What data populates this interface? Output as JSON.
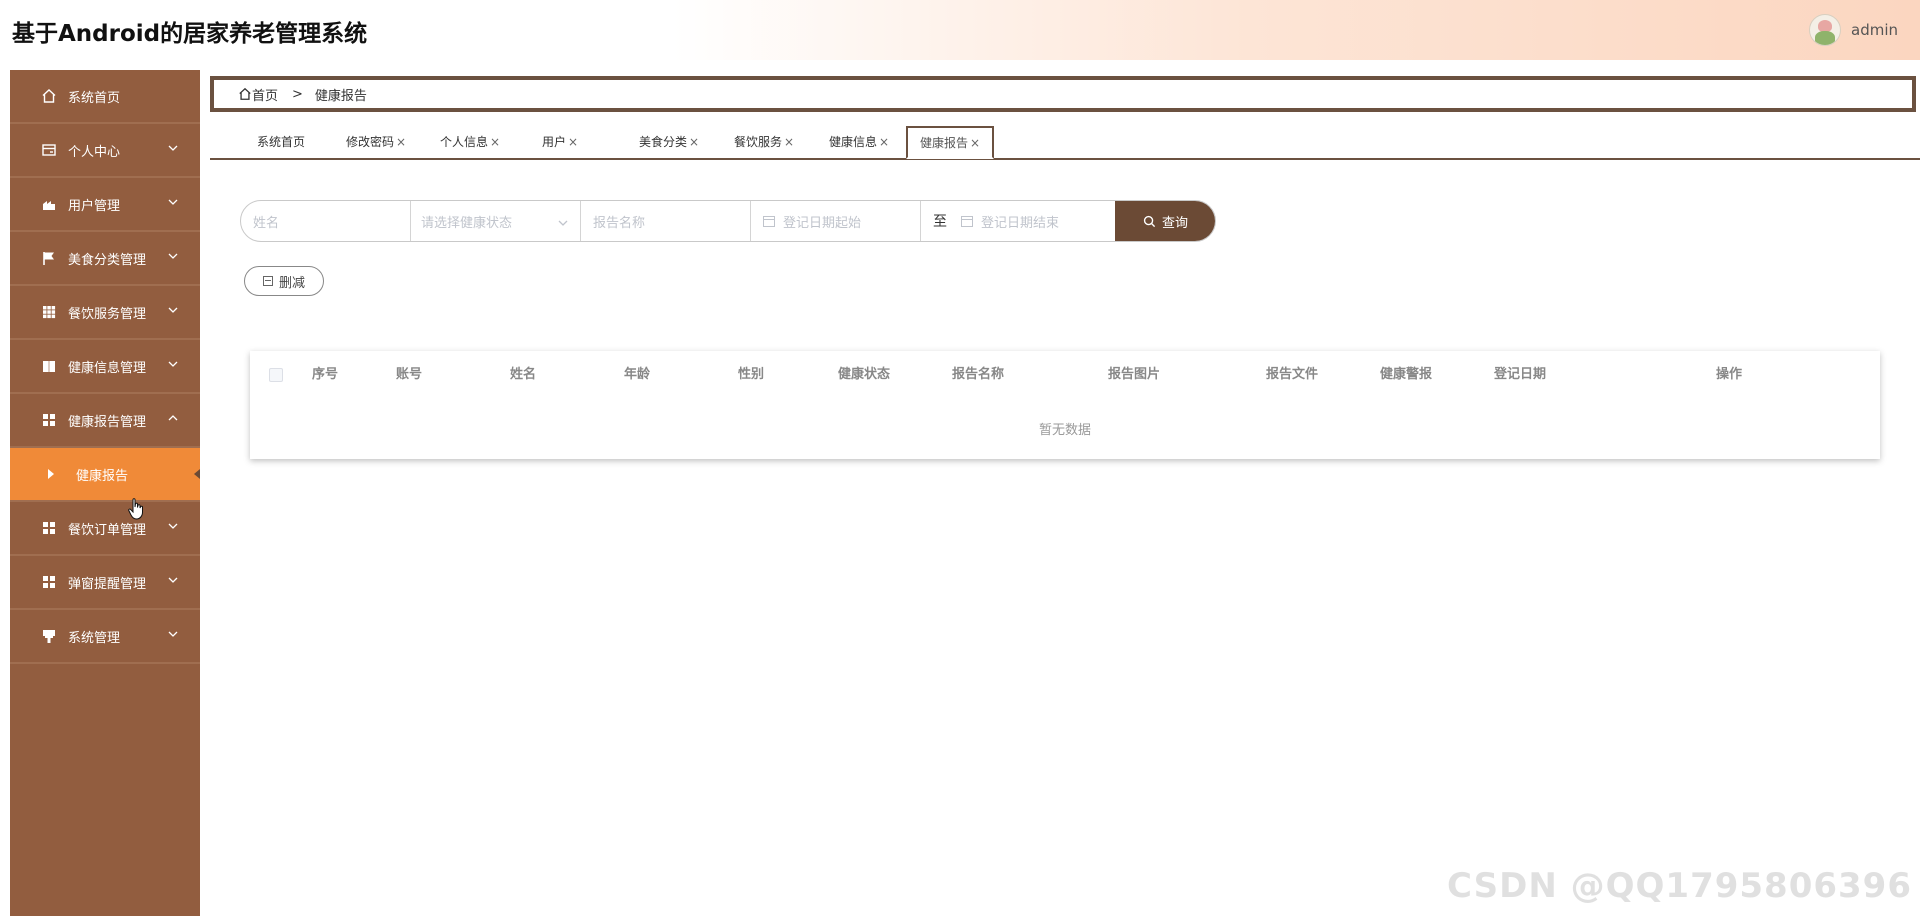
{
  "header": {
    "title": "基于Android的居家养老管理系统",
    "username": "admin"
  },
  "sidebar": {
    "items": [
      {
        "label": "系统首页",
        "icon": "home-icon"
      },
      {
        "label": "个人中心",
        "icon": "wallet-icon"
      },
      {
        "label": "用户管理",
        "icon": "user-manage-icon"
      },
      {
        "label": "美食分类管理",
        "icon": "flag-icon"
      },
      {
        "label": "餐饮服务管理",
        "icon": "grid-icon"
      },
      {
        "label": "健康信息管理",
        "icon": "book-icon"
      },
      {
        "label": "健康报告管理",
        "icon": "grid-icon"
      },
      {
        "label": "健康报告",
        "icon": "caret-right-icon"
      },
      {
        "label": "餐饮订单管理",
        "icon": "grid-icon"
      },
      {
        "label": "弹窗提醒管理",
        "icon": "grid-icon"
      },
      {
        "label": "系统管理",
        "icon": "system-icon"
      }
    ]
  },
  "breadcrumb": {
    "home": "首页",
    "separator": ">",
    "current": "健康报告"
  },
  "tabs": [
    {
      "label": "系统首页"
    },
    {
      "label": "修改密码"
    },
    {
      "label": "个人信息"
    },
    {
      "label": "用户"
    },
    {
      "label": "美食分类"
    },
    {
      "label": "餐饮服务"
    },
    {
      "label": "健康信息"
    },
    {
      "label": "健康报告"
    }
  ],
  "tab_close_glyph": "×",
  "search": {
    "name_placeholder": "姓名",
    "status_placeholder": "请选择健康状态",
    "report_name_placeholder": "报告名称",
    "date_start_placeholder": "登记日期起始",
    "date_to": "至",
    "date_end_placeholder": "登记日期结束",
    "query_label": "查询"
  },
  "actions": {
    "delete_label": "删减"
  },
  "table": {
    "columns": [
      "序号",
      "账号",
      "姓名",
      "年龄",
      "性别",
      "健康状态",
      "报告名称",
      "报告图片",
      "报告文件",
      "健康警报",
      "登记日期",
      "操作"
    ],
    "empty_text": "暂无数据"
  },
  "watermark": "CSDN @QQ1795806396",
  "colors": {
    "sidebar_bg": "#925d3f",
    "active_item": "#f08a38",
    "accent_dark": "#6b4a35"
  }
}
